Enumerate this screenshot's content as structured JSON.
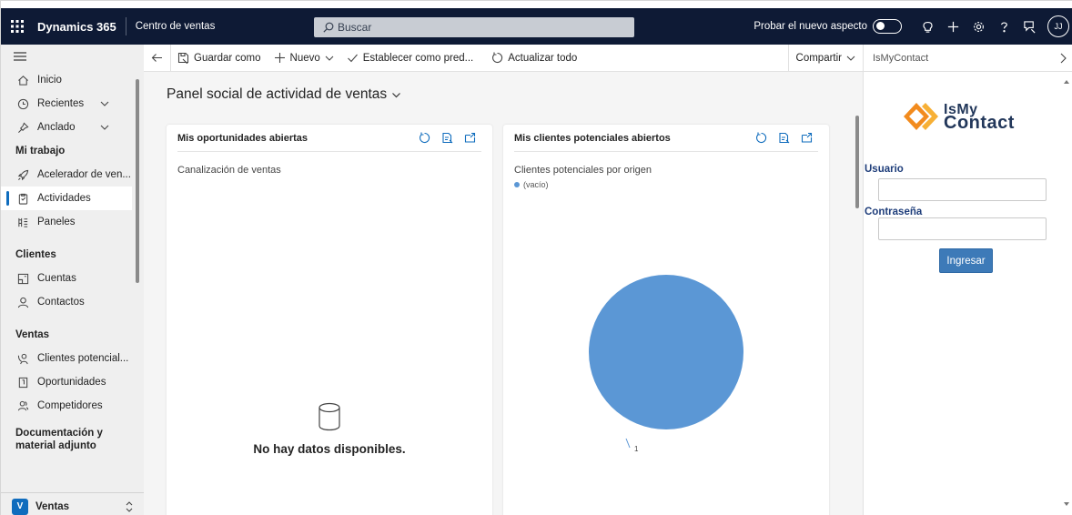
{
  "topbar": {
    "brand": "Dynamics 365",
    "app_name": "Centro de ventas",
    "search_placeholder": "Buscar",
    "try_new_look": "Probar el nuevo aspecto",
    "avatar_initials": "JJ"
  },
  "nav": {
    "items_top": [
      {
        "label": "Inicio",
        "icon": "home-icon"
      },
      {
        "label": "Recientes",
        "icon": "clock-icon"
      },
      {
        "label": "Anclado",
        "icon": "pin-icon"
      }
    ],
    "groups": [
      {
        "title": "Mi trabajo",
        "items": [
          {
            "label": "Acelerador de ven...",
            "icon": "rocket-icon"
          },
          {
            "label": "Actividades",
            "icon": "clipboard-icon",
            "selected": true
          },
          {
            "label": "Paneles",
            "icon": "dashboard-icon"
          }
        ]
      },
      {
        "title": "Clientes",
        "items": [
          {
            "label": "Cuentas",
            "icon": "building-icon"
          },
          {
            "label": "Contactos",
            "icon": "person-icon"
          }
        ]
      },
      {
        "title": "Ventas",
        "items": [
          {
            "label": "Clientes potencial...",
            "icon": "phone-person-icon"
          },
          {
            "label": "Oportunidades",
            "icon": "document-icon"
          },
          {
            "label": "Competidores",
            "icon": "people-icon"
          }
        ]
      },
      {
        "title": "Documentación y material adjunto",
        "items": []
      }
    ],
    "area": {
      "badge": "V",
      "label": "Ventas"
    }
  },
  "commandbar": {
    "save_as": "Guardar como",
    "new": "Nuevo",
    "set_default": "Establecer como pred...",
    "refresh_all": "Actualizar todo",
    "share": "Compartir"
  },
  "main": {
    "title": "Panel social de actividad de ventas",
    "cards": [
      {
        "title": "Mis oportunidades abiertas",
        "subtitle": "Canalización de ventas",
        "empty_text": "No hay datos disponibles."
      },
      {
        "title": "Mis clientes potenciales abiertos",
        "subtitle": "Clientes potenciales por origen",
        "legend": "(vacío)",
        "slice_label": "1"
      }
    ]
  },
  "side_pane": {
    "title": "IsMyContact",
    "logo_line1": "IsMy",
    "logo_line2": "Contact",
    "user_label": "Usuario",
    "password_label": "Contraseña",
    "login_button": "Ingresar"
  },
  "chart_data": {
    "type": "pie",
    "title": "Clientes potenciales por origen",
    "legend": [
      "(vacío)"
    ],
    "series": [
      {
        "values": [
          1
        ]
      }
    ],
    "categories": [
      "(vacío)"
    ],
    "colors": [
      "#5b97d5"
    ]
  }
}
